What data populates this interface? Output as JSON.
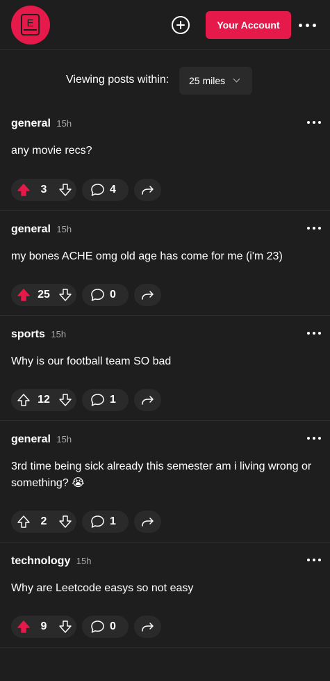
{
  "header": {
    "logo_letter": "E",
    "account_label": "Your Account"
  },
  "filter": {
    "label": "Viewing posts within:",
    "value": "25 miles"
  },
  "colors": {
    "accent": "#e5194a",
    "background": "#1e1e1e",
    "pill": "#2a2a2a",
    "muted_text": "#a8a8a8"
  },
  "posts": [
    {
      "category": "general",
      "time": "15h",
      "body": "any movie recs?",
      "votes": "3",
      "upvoted": true,
      "comments": "4"
    },
    {
      "category": "general",
      "time": "15h",
      "body": "my bones ACHE omg old age has come for me (i'm 23)",
      "votes": "25",
      "upvoted": true,
      "comments": "0"
    },
    {
      "category": "sports",
      "time": "15h",
      "body": "Why is our football team SO bad",
      "votes": "12",
      "upvoted": false,
      "comments": "1"
    },
    {
      "category": "general",
      "time": "15h",
      "body": "3rd time being sick already this semester am i living wrong or something? 😭",
      "votes": "2",
      "upvoted": false,
      "comments": "1"
    },
    {
      "category": "technology",
      "time": "15h",
      "body": "Why are Leetcode easys so not easy",
      "votes": "9",
      "upvoted": true,
      "comments": "0"
    }
  ]
}
